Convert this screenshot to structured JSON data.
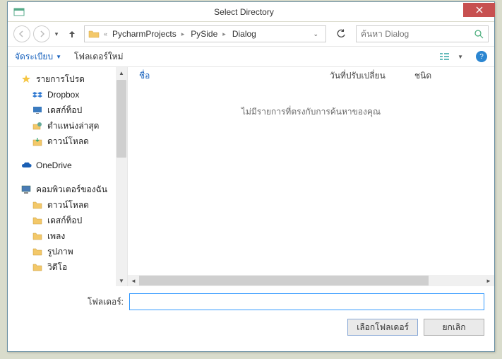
{
  "window": {
    "title": "Select Directory"
  },
  "breadcrumb": {
    "prefix_label": "«",
    "parts": [
      "PycharmProjects",
      "PySide",
      "Dialog"
    ]
  },
  "search": {
    "placeholder": "ค้นหา Dialog"
  },
  "toolbar": {
    "organize": "จัดระเบียบ",
    "new_folder": "โฟลเดอร์ใหม่"
  },
  "sidebar": {
    "favorites": {
      "label": "รายการโปรด",
      "items": [
        {
          "label": "Dropbox",
          "icon": "dropbox"
        },
        {
          "label": "เดสก์ท็อป",
          "icon": "desktop"
        },
        {
          "label": "ตำแหน่งล่าสุด",
          "icon": "recent"
        },
        {
          "label": "ดาวน์โหลด",
          "icon": "download"
        }
      ]
    },
    "onedrive": {
      "label": "OneDrive"
    },
    "thispc": {
      "label": "คอมพิวเตอร์ของฉัน",
      "items": [
        {
          "label": "ดาวน์โหลด"
        },
        {
          "label": "เดสก์ท็อป"
        },
        {
          "label": "เพลง"
        },
        {
          "label": "รูปภาพ"
        },
        {
          "label": "วิดีโอ"
        }
      ]
    }
  },
  "columns": {
    "name": "ชื่อ",
    "date": "วันที่ปรับเปลี่ยน",
    "type": "ชนิด"
  },
  "empty_message": "ไม่มีรายการที่ตรงกับการค้นหาของคุณ",
  "footer": {
    "folder_label": "โฟลเดอร์:",
    "folder_value": "",
    "select_label": "เลือกโฟลเดอร์",
    "cancel_label": "ยกเลิก"
  }
}
